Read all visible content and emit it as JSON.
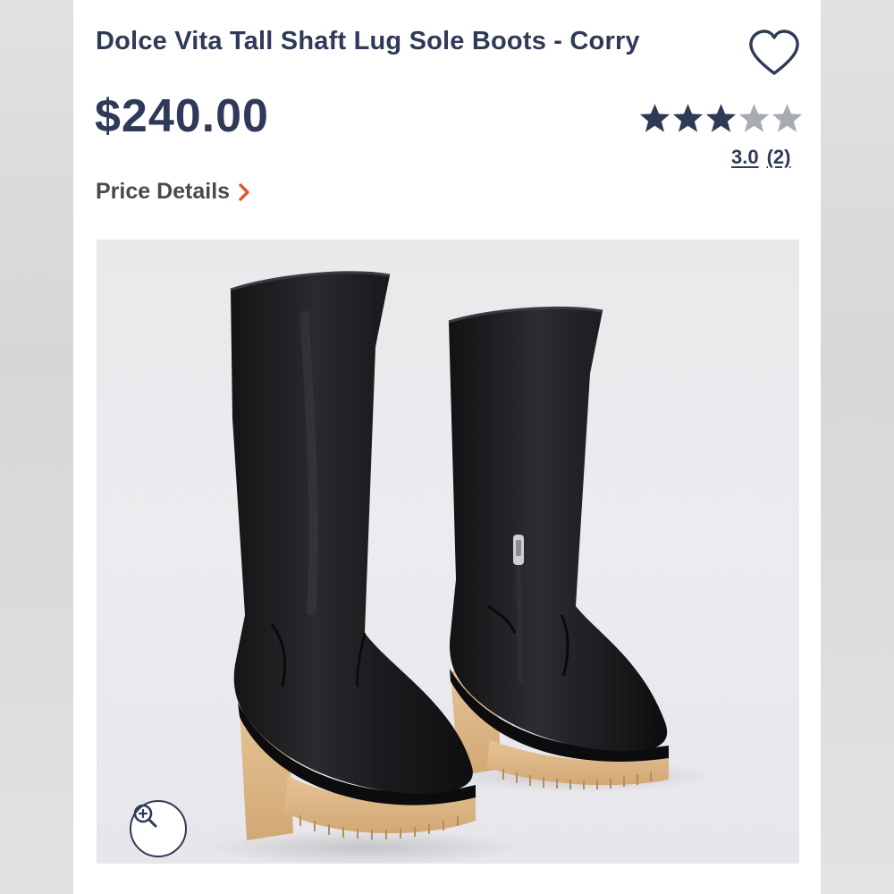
{
  "product": {
    "title": "Dolce Vita Tall Shaft Lug Sole Boots - Corry",
    "price": "$240.00",
    "price_details_label": "Price Details",
    "rating": {
      "stars_filled": 3,
      "stars_total": 5,
      "value": "3.0",
      "count": "(2)"
    }
  },
  "icons": {
    "favorite": "heart-outline-icon",
    "price_details": "chevron-right-icon",
    "zoom": "zoom-in-icon"
  },
  "colors": {
    "text_primary": "#2e3a57",
    "text_secondary": "#4a4a4a",
    "accent": "#e8542b",
    "star_filled": "#2e3a57",
    "star_empty": "#a8abb2"
  }
}
